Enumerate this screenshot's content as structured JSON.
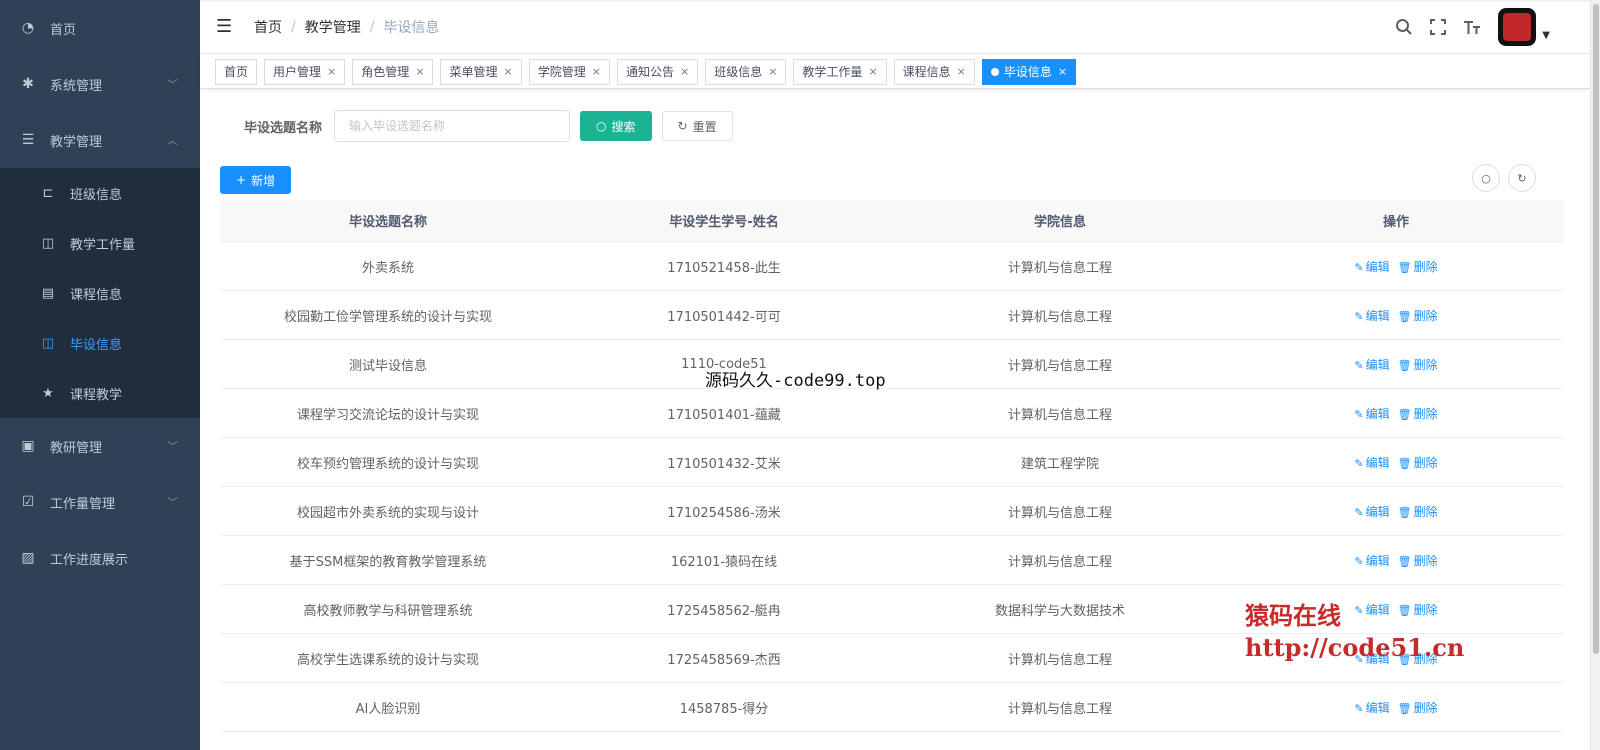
{
  "sidebar": {
    "items": [
      {
        "label": "首页",
        "icon": "dashboard-icon"
      },
      {
        "label": "系统管理",
        "icon": "gear-icon"
      },
      {
        "label": "教学管理",
        "icon": "sliders-icon"
      },
      {
        "label": "教研管理",
        "icon": "message-icon"
      },
      {
        "label": "工作量管理",
        "icon": "checkbox-icon"
      },
      {
        "label": "工作进度展示",
        "icon": "picture-icon"
      }
    ],
    "submenu": [
      {
        "label": "班级信息",
        "icon": "tree-icon"
      },
      {
        "label": "教学工作量",
        "icon": "book-icon"
      },
      {
        "label": "课程信息",
        "icon": "document-icon"
      },
      {
        "label": "毕设信息",
        "icon": "book-open-icon"
      },
      {
        "label": "课程教学",
        "icon": "star-icon"
      }
    ]
  },
  "breadcrumb": {
    "items": [
      "首页",
      "教学管理",
      "毕设信息"
    ]
  },
  "tags": [
    {
      "label": "首页"
    },
    {
      "label": "用户管理"
    },
    {
      "label": "角色管理"
    },
    {
      "label": "菜单管理"
    },
    {
      "label": "学院管理"
    },
    {
      "label": "通知公告"
    },
    {
      "label": "班级信息"
    },
    {
      "label": "教学工作量"
    },
    {
      "label": "课程信息"
    },
    {
      "label": "毕设信息"
    }
  ],
  "search": {
    "label": "毕设选题名称",
    "placeholder": "输入毕设选题名称",
    "search_btn": "搜索",
    "reset_btn": "重置",
    "add_btn": "新增"
  },
  "table": {
    "headers": [
      "毕设选题名称",
      "毕设学生学号-姓名",
      "学院信息",
      "操作"
    ],
    "edit_label": "编辑",
    "delete_label": "删除",
    "rows": [
      [
        "外卖系统",
        "1710521458-此生",
        "计算机与信息工程"
      ],
      [
        "校园勤工俭学管理系统的设计与实现",
        "1710501442-可可",
        "计算机与信息工程"
      ],
      [
        "测试毕设信息",
        "1110-code51",
        "计算机与信息工程"
      ],
      [
        "课程学习交流论坛的设计与实现",
        "1710501401-蕴藏",
        "计算机与信息工程"
      ],
      [
        "校车预约管理系统的设计与实现",
        "1710501432-艾米",
        "建筑工程学院"
      ],
      [
        "校园超市外卖系统的实现与设计",
        "1710254586-汤米",
        "计算机与信息工程"
      ],
      [
        "基于SSM框架的教育教学管理系统",
        "162101-猿码在线",
        "计算机与信息工程"
      ],
      [
        "高校教师教学与科研管理系统",
        "1725458562-艇冉",
        "数据科学与大数据技术"
      ],
      [
        "高校学生选课系统的设计与实现",
        "1725458569-杰西",
        "计算机与信息工程"
      ],
      [
        "AI人脸识别",
        "1458785-得分",
        "计算机与信息工程"
      ]
    ]
  },
  "watermarks": {
    "center": "源码久久-code99.top",
    "corner_line1": "猿码在线",
    "corner_line2": "http://code51.cn"
  },
  "colors": {
    "sidebar_bg": "#304156",
    "submenu_bg": "#1f2d3d",
    "primary": "#1890ff",
    "search_btn": "#1ab394",
    "watermark_red": "#c62a2a"
  }
}
